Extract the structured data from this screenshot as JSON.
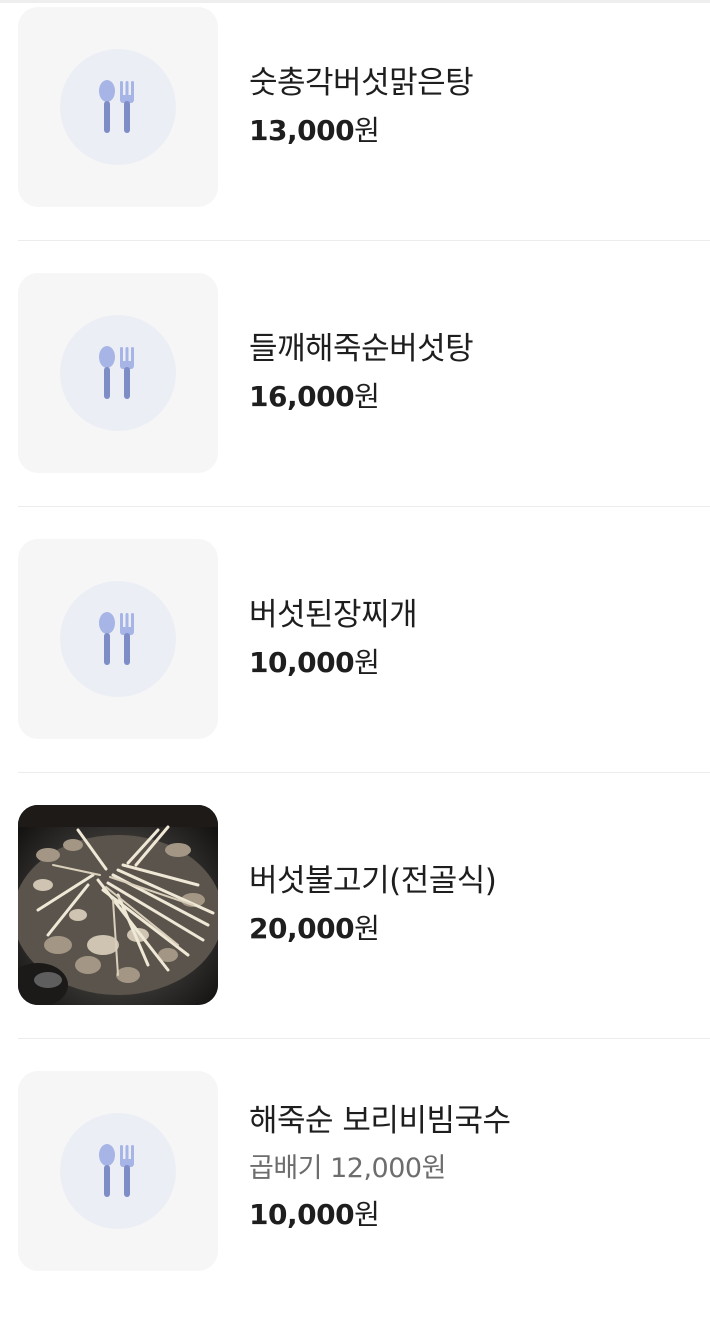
{
  "menu": {
    "items": [
      {
        "name": "숫총각버섯맑은탕",
        "price": "13,000",
        "unit": "원",
        "image": "fork-spoon-icon"
      },
      {
        "name": "들깨해죽순버섯탕",
        "price": "16,000",
        "unit": "원",
        "image": "fork-spoon-icon"
      },
      {
        "name": "버섯된장찌개",
        "price": "10,000",
        "unit": "원",
        "image": "fork-spoon-icon"
      },
      {
        "name": "버섯불고기(전골식)",
        "price": "20,000",
        "unit": "원",
        "image": "mushroom-hotpot-photo"
      },
      {
        "name": "해죽순 보리비빔국수",
        "sub_price": "곱배기 12,000원",
        "price": "10,000",
        "unit": "원",
        "image": "fork-spoon-icon"
      }
    ]
  },
  "colors": {
    "icon_circle": "#ebeef4",
    "icon_fill": "#7f8dc7",
    "thumb_bg": "#f6f6f6"
  }
}
